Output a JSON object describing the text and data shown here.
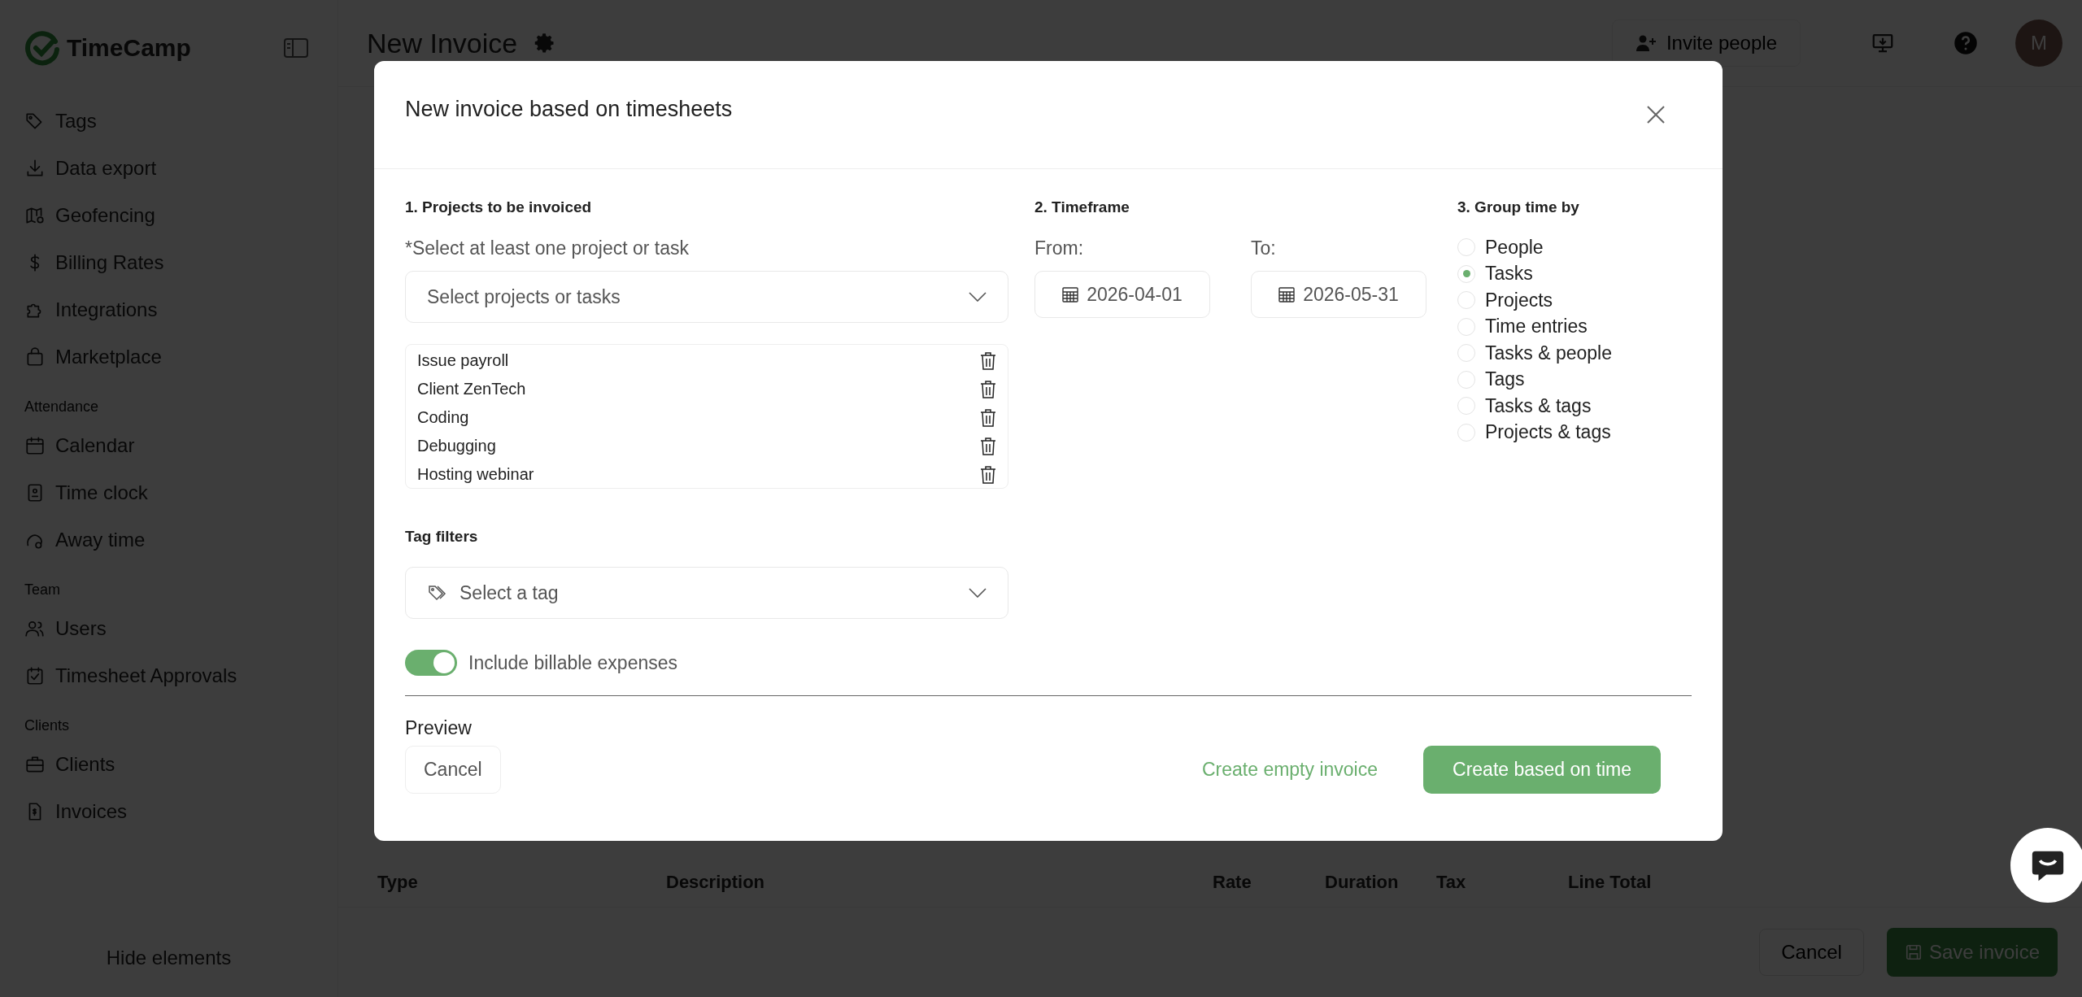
{
  "sidebar": {
    "logo": "TimeCamp",
    "sections": [
      {
        "items": [
          "Tags",
          "Data export",
          "Geofencing",
          "Billing Rates",
          "Integrations",
          "Marketplace"
        ]
      },
      {
        "heading": "Attendance",
        "items": [
          "Calendar",
          "Time clock",
          "Away time"
        ]
      },
      {
        "heading": "Team",
        "items": [
          "Users",
          "Timesheet Approvals"
        ]
      },
      {
        "heading": "Clients",
        "items": [
          "Clients",
          "Invoices"
        ]
      }
    ],
    "footer": "Hide elements"
  },
  "header": {
    "title": "New Invoice",
    "invite": "Invite people",
    "avatar": "M"
  },
  "table": {
    "columns": [
      "Type",
      "Description",
      "Rate",
      "Duration",
      "Tax",
      "Line Total"
    ]
  },
  "footer_buttons": {
    "cancel": "Cancel",
    "save": "Save invoice"
  },
  "modal": {
    "title": "New invoice based on timesheets",
    "projects": {
      "heading": "1. Projects to be invoiced",
      "hint": "*Select at least one project or task",
      "placeholder": "Select projects or tasks",
      "items": [
        "Issue payroll",
        "Client ZenTech",
        "Coding",
        "Debugging",
        "Hosting webinar"
      ]
    },
    "timeframe": {
      "heading": "2. Timeframe",
      "from_label": "From:",
      "from": "2026-04-01",
      "to_label": "To:",
      "to": "2026-05-31"
    },
    "group": {
      "heading": "3. Group time by",
      "options": [
        {
          "label": "People",
          "selected": false
        },
        {
          "label": "Tasks",
          "selected": true
        },
        {
          "label": "Projects",
          "selected": false
        },
        {
          "label": "Time entries",
          "selected": false
        },
        {
          "label": "Tasks & people",
          "selected": false
        },
        {
          "label": "Tags",
          "selected": false
        },
        {
          "label": "Tasks & tags",
          "selected": false
        },
        {
          "label": "Projects & tags",
          "selected": false
        }
      ]
    },
    "tags": {
      "heading": "Tag filters",
      "placeholder": "Select a tag"
    },
    "toggle": {
      "label": "Include billable expenses",
      "on": true
    },
    "preview": "Preview",
    "buttons": {
      "cancel": "Cancel",
      "empty": "Create empty invoice",
      "create": "Create based on time"
    }
  }
}
